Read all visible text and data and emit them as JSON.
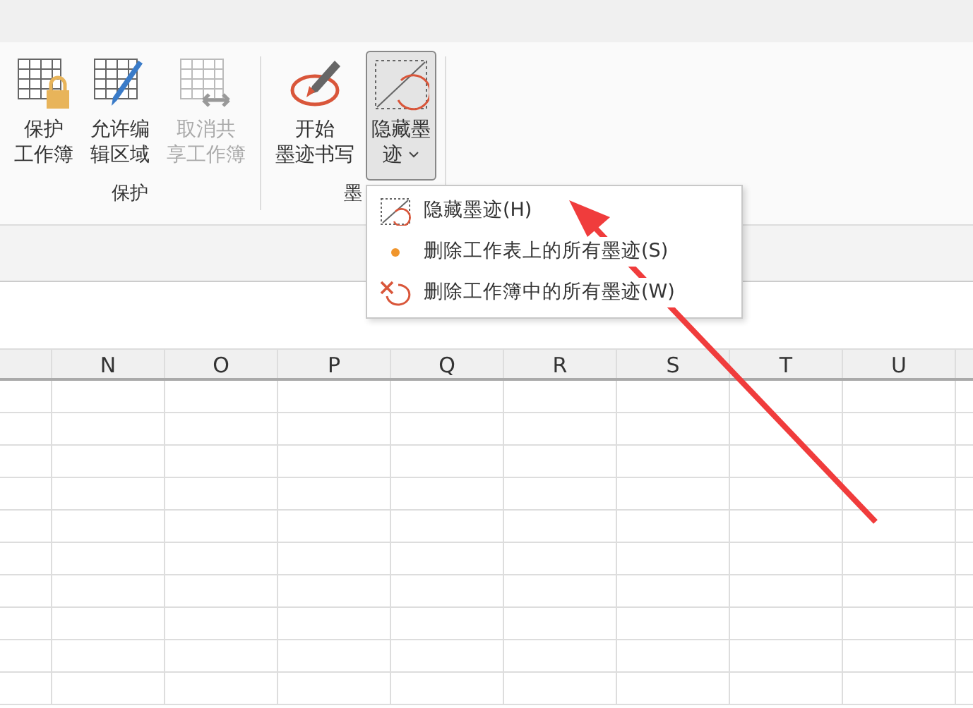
{
  "ribbon": {
    "groups": [
      {
        "label": "保护",
        "buttons": [
          {
            "kind": "protect-workbook",
            "lines": [
              "保护",
              "工作簿"
            ],
            "disabled": false,
            "selected": false,
            "dropdown": false
          },
          {
            "kind": "allow-edit",
            "lines": [
              "允许编",
              "辑区域"
            ],
            "disabled": false,
            "selected": false,
            "dropdown": false
          },
          {
            "kind": "unshare",
            "lines": [
              "取消共",
              "享工作簿"
            ],
            "disabled": true,
            "selected": false,
            "dropdown": false
          }
        ]
      },
      {
        "label": "墨",
        "buttons": [
          {
            "kind": "start-ink",
            "lines": [
              "开始",
              "墨迹书写"
            ],
            "disabled": false,
            "selected": false,
            "dropdown": false
          },
          {
            "kind": "hide-ink",
            "lines": [
              "隐藏墨",
              "迹"
            ],
            "disabled": false,
            "selected": true,
            "dropdown": true
          }
        ]
      }
    ]
  },
  "menu": {
    "items": [
      {
        "kind": "hide-ink",
        "label": "隐藏墨迹(H)"
      },
      {
        "kind": "dot",
        "label": "删除工作表上的所有墨迹(S)"
      },
      {
        "kind": "erase",
        "label": "删除工作簿中的所有墨迹(W)"
      }
    ]
  },
  "sheet": {
    "columns": [
      "N",
      "O",
      "P",
      "Q",
      "R",
      "S",
      "T",
      "U"
    ]
  }
}
